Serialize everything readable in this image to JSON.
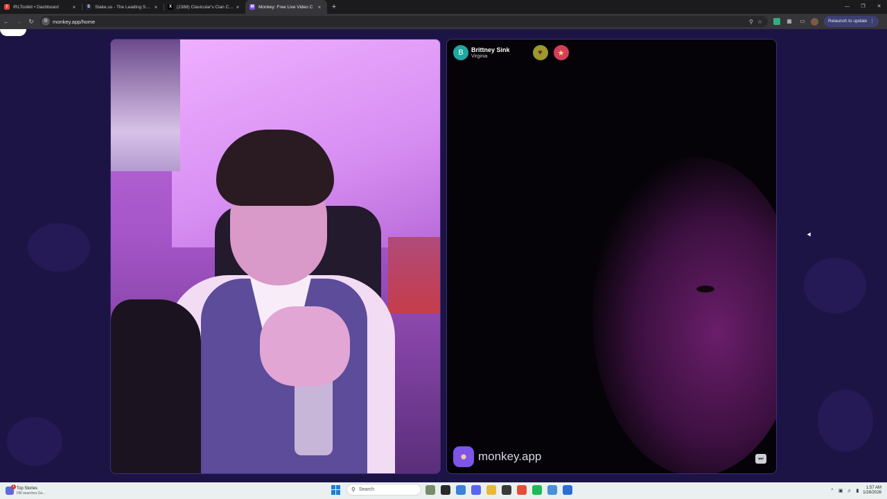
{
  "browser": {
    "tabs": [
      {
        "title": "IRLToolkit • Dashboard",
        "favicon": "irltoolkit-icon",
        "favicon_color": "#e0443a",
        "favicon_glyph": "I",
        "active": false
      },
      {
        "title": "Stake.us - The Leading Social C",
        "favicon": "stake-icon",
        "favicon_color": "#1e2a38",
        "favicon_glyph": "S",
        "active": false
      },
      {
        "title": "(2388) Clavicular's Clan Comm",
        "favicon": "x-icon",
        "favicon_color": "#000000",
        "favicon_glyph": "X",
        "active": false
      },
      {
        "title": "Monkey: Free Live Video C",
        "favicon": "monkey-icon",
        "favicon_color": "#7d55e8",
        "favicon_glyph": "M",
        "active": true
      }
    ],
    "new_tab_glyph": "+",
    "close_glyph": "×",
    "url": "monkey.app/home",
    "relaunch_label": "Relaunch to update"
  },
  "remote_user": {
    "initial": "B",
    "name": "Brittney Sink",
    "location": "Virginia",
    "avatar_color": "#1fa7a1"
  },
  "brand": {
    "name": "monkey.app",
    "logo": "monkey-face-icon"
  },
  "taskbar": {
    "news_title": "Top Stories",
    "news_sub": "FBI searches Ge...",
    "news_count": "1",
    "search_placeholder": "Search",
    "time": "1:57 AM",
    "date": "1/28/2026"
  }
}
